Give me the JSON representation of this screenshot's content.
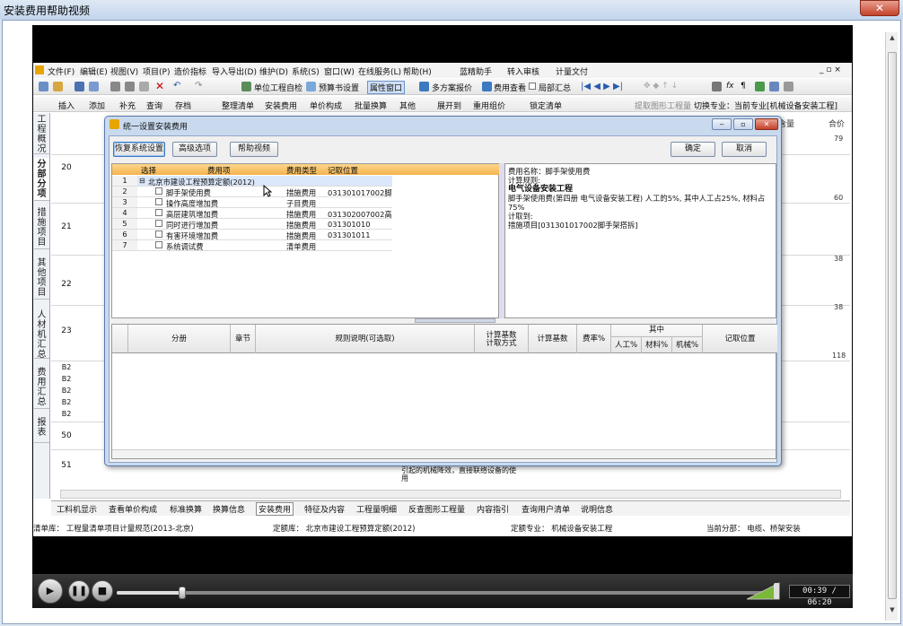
{
  "window": {
    "title": "安装费用帮助视频",
    "close": "✕"
  },
  "menu": [
    "文件(F)",
    "编辑(E)",
    "视图(V)",
    "项目(P)",
    "造价指标",
    "导入导出(D)",
    "维护(D)",
    "系统(S)",
    "窗口(W)",
    "在线服务(L)",
    "帮助(H)",
    "蓝精助手",
    "转入审核",
    "计量文付"
  ],
  "menu_right": "_ ▫ ×",
  "toolbar1": [
    "单位工程自检",
    "预算书设置",
    "属性窗口",
    "多方案报价",
    "费用查看",
    "局部汇总"
  ],
  "toolbar2": [
    "插入",
    "添加",
    "补充",
    "查询",
    "存档",
    "整理清单",
    "安装费用",
    "单价构成",
    "批量换算",
    "其他",
    "展开到",
    "重用组价",
    "锁定清单",
    "提取图形工程量",
    "切换专业：当前专业[机械设备安装工程]"
  ],
  "side_tabs": [
    "工程概况",
    "分部分项",
    "措施项目",
    "其他项目",
    "人材机汇总",
    "费用汇总",
    "报表"
  ],
  "grid": {
    "rows": [
      "20",
      "21",
      "22",
      "23",
      "B2",
      "B2",
      "B2",
      "B2",
      "B2",
      "50",
      "51"
    ],
    "right_header": "合价",
    "right_header2": "含量",
    "right_values": [
      "79",
      "60",
      "38",
      "38",
      "118"
    ],
    "row51_text": "引起的机械降效，直接联络设备的使用"
  },
  "bottom_tabs": [
    "工料机显示",
    "查看单价构成",
    "标准换算",
    "换算信息",
    "安装费用",
    "特征及内容",
    "工程量明细",
    "反查图形工程量",
    "内容指引",
    "查询用户清单",
    "说明信息"
  ],
  "status": {
    "list": "清单库： 工程量清单项目计量规范(2013-北京)",
    "quota": "定额库： 北京市建设工程预算定额(2012)",
    "spec": "定额专业： 机械设备安装工程",
    "part": "当前分部： 电缆、桥架安装"
  },
  "dialog": {
    "title": "统一设置安装费用",
    "buttons": {
      "restore": "恢复系统设置",
      "advanced": "高级选项",
      "help": "帮助视频",
      "ok": "确定",
      "cancel": "取消"
    },
    "tree_headers": [
      "选择",
      "费用项",
      "费用类型",
      "记取位置"
    ],
    "tree_rows": [
      {
        "n": "1",
        "name": "北京市建设工程预算定额(2012)",
        "type": "",
        "pos": ""
      },
      {
        "n": "2",
        "name": "脚手架使用费",
        "type": "措施费用",
        "pos": "031301017002脚"
      },
      {
        "n": "3",
        "name": "操作高度增加费",
        "type": "子目费用",
        "pos": ""
      },
      {
        "n": "4",
        "name": "高层建筑增加费",
        "type": "措施费用",
        "pos": "031302007002高"
      },
      {
        "n": "5",
        "name": "同时进行增加费",
        "type": "措施费用",
        "pos": "031301010"
      },
      {
        "n": "6",
        "name": "有害环境增加费",
        "type": "措施费用",
        "pos": "031301011"
      },
      {
        "n": "7",
        "name": "系统调试费",
        "type": "清单费用",
        "pos": ""
      }
    ],
    "desc": {
      "l1": "费用名称：脚手架使用费",
      "l2": "计算规则:",
      "l3": "电气设备安装工程",
      "l4": "脚手架使用费(第四册 电气设备安装工程) 人工的5%, 其中人工占25%, 材料占75%",
      "l5": "计取到:",
      "l6": "措施项目[031301017002脚手架搭拆]"
    },
    "lower_headers": {
      "part": "分册",
      "chapter": "章节",
      "rule": "规则说明(可选取)",
      "basis_method": "计算基数 计取方式",
      "basis": "计算基数",
      "rate": "费率%",
      "of_which": "其中",
      "labor": "人工%",
      "material": "材料%",
      "machine": "机械%",
      "pos": "记取位置"
    }
  },
  "player": {
    "time": "00:39 / 06:20",
    "progress": 0.1
  }
}
